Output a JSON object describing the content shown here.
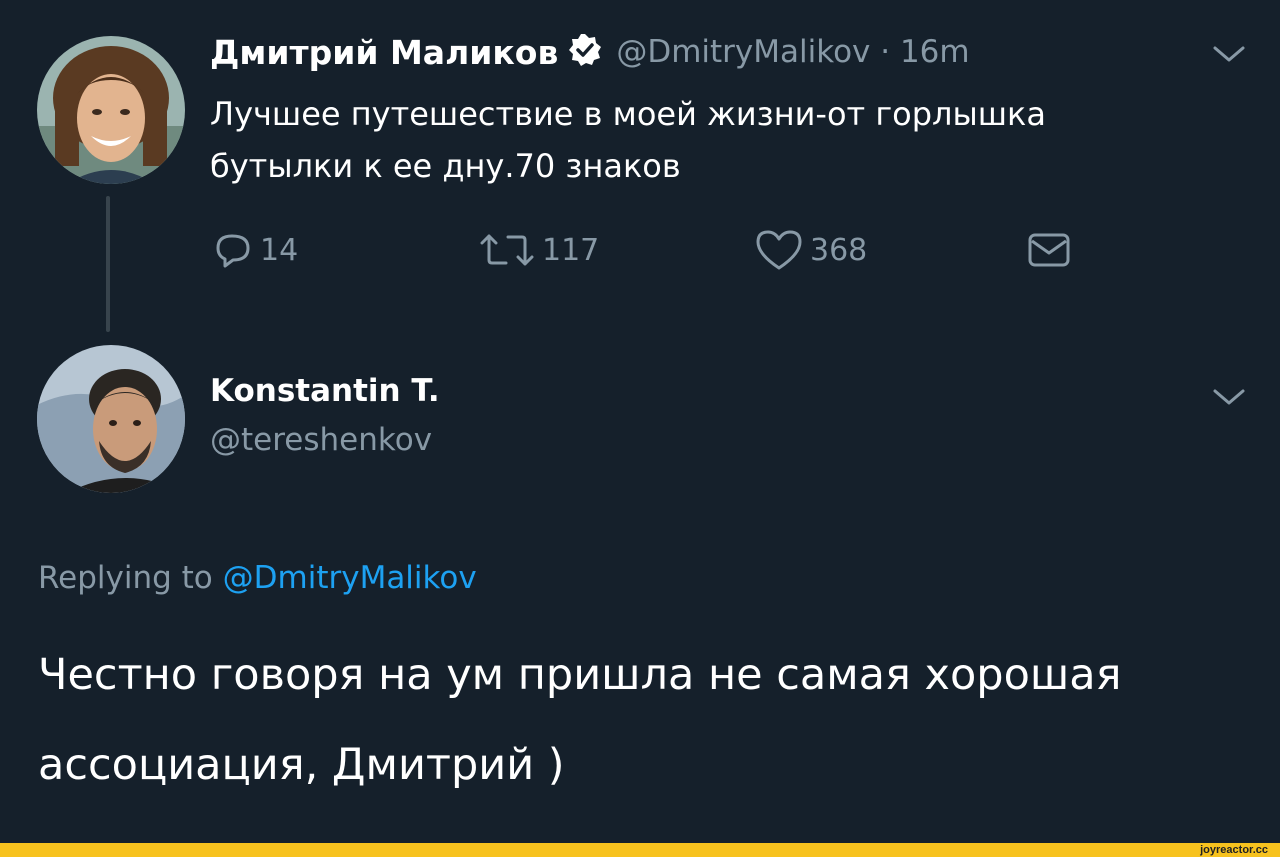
{
  "tweet1": {
    "display_name": "Дмитрий Маликов",
    "verified_icon": "verified-badge-icon",
    "handle_time": "@DmitryMalikov · 16m",
    "text": "Лучшее путешествие в моей жизни-от горлышка бутылки к ее дну.70 знаков",
    "actions": {
      "reply_count": "14",
      "retweet_count": "117",
      "like_count": "368"
    }
  },
  "tweet2": {
    "display_name": "Konstantin T.",
    "handle": "@tereshenkov",
    "replying_prefix": "Replying to",
    "replying_mention": "@DmitryMalikov",
    "text": "Честно говоря на ум пришла не самая хорошая ассоциация, Дмитрий )"
  },
  "watermark": "joyreactor.cc",
  "colors": {
    "background": "#15202b",
    "secondary_text": "#8899a6",
    "link": "#1da1f2",
    "thread_line": "#38444d",
    "footer_bar": "#f7c21e"
  }
}
